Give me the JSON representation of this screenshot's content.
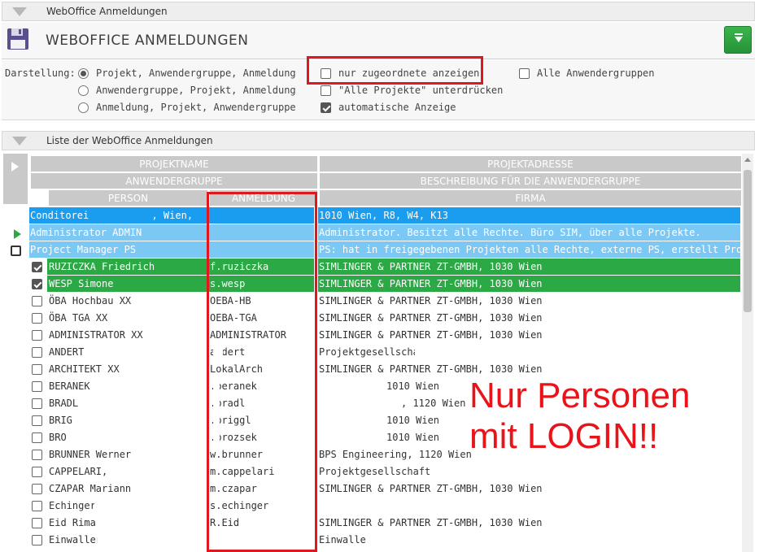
{
  "top_panel": {
    "title": "WebOffice Anmeldungen"
  },
  "title_bar": {
    "title": "WEBOFFICE ANMELDUNGEN",
    "icon": "floppy-disk-icon",
    "action_icon": "download-icon"
  },
  "options": {
    "label": "Darstellung:",
    "radios": [
      {
        "label": "Projekt, Anwendergruppe, Anmeldung",
        "selected": true
      },
      {
        "label": "Anwendergruppe, Projekt, Anmeldung",
        "selected": false
      },
      {
        "label": "Anmeldung, Projekt, Anwendergruppe",
        "selected": false
      }
    ],
    "checkboxes": [
      {
        "label": "nur zugeordnete anzeigen",
        "checked": false
      },
      {
        "label": "\"Alle Projekte\" unterdrücken",
        "checked": false
      },
      {
        "label": "automatische Anzeige",
        "checked": true
      },
      {
        "label": "Alle Anwendergruppen",
        "checked": false
      }
    ]
  },
  "list_panel": {
    "title": "Liste der WebOffice Anmeldungen"
  },
  "headers": {
    "projektname": "PROJEKTNAME",
    "projektadresse": "PROJEKTADRESSE",
    "anwendergruppe": "ANWENDERGRUPPE",
    "beschreibung": "BESCHREIBUNG FÜR DIE ANWENDERGRUPPE",
    "person": "PERSON",
    "anmeldung": "ANMELDUNG",
    "firma": "FIRMA"
  },
  "project_row": {
    "name": "Conditorei ",
    "name2": ", Wien,",
    "address": "1010 Wien, R8, W4, K13"
  },
  "group_rows": [
    {
      "name": "Administrator ADMIN",
      "description": "Administrator. Besitzt alle Rechte. Büro SIM, über alle Projekte."
    },
    {
      "name": "Project Manager PS",
      "description": "PS: hat in freigegebenen Projekten alle Rechte, externe PS, erstellt Projektbesprechu"
    }
  ],
  "person_rows": [
    {
      "person": "RUZICZKA Friedrich",
      "login": "f.ruziczka",
      "firma": "SIMLINGER & PARTNER ZT-GMBH, 1030 Wien",
      "checked": true,
      "highlight": true
    },
    {
      "person": "WESP Simone",
      "login": "s.wesp",
      "firma": "SIMLINGER & PARTNER ZT-GMBH, 1030 Wien",
      "checked": true,
      "highlight": true
    },
    {
      "person": "ÖBA Hochbau XX",
      "login": "OEBA-HB",
      "firma": "SIMLINGER & PARTNER ZT-GMBH, 1030 Wien",
      "checked": false,
      "highlight": false
    },
    {
      "person": "ÖBA TGA XX",
      "login": "OEBA-TGA",
      "firma": "SIMLINGER & PARTNER ZT-GMBH, 1030 Wien",
      "checked": false,
      "highlight": false
    },
    {
      "person": "ADMINISTRATOR XX",
      "login": "ADMINISTRATOR",
      "firma": "SIMLINGER & PARTNER ZT-GMBH, 1030 Wien",
      "checked": false,
      "highlight": false
    },
    {
      "person": "ANDERT",
      "login": "andert",
      "firma": "Projektgesellschaft",
      "checked": false,
      "highlight": false
    },
    {
      "person": "ARCHITEKT XX",
      "login": "LokalArch",
      "firma": "SIMLINGER & PARTNER ZT-GMBH, 1030 Wien",
      "checked": false,
      "highlight": false
    },
    {
      "person": "BERANEK",
      "login": ".beranek",
      "firma": "1010 Wien",
      "checked": false,
      "highlight": false
    },
    {
      "person": "BRADL",
      "login": ".bradl",
      "firma": ", 1120 Wien",
      "checked": false,
      "highlight": false
    },
    {
      "person": "BRIG",
      "login": ".briggl",
      "firma": "1010 Wien",
      "checked": false,
      "highlight": false
    },
    {
      "person": "BRO",
      "login": ".brozsek",
      "firma": "1010 Wien",
      "checked": false,
      "highlight": false
    },
    {
      "person": "BRUNNER Werner",
      "login": "w.brunner",
      "firma": "BPS Engineering, 1120 Wien",
      "checked": false,
      "highlight": false
    },
    {
      "person": "CAPPELARI,",
      "login": "m.cappelari",
      "firma": "Projektgesellschaft",
      "checked": false,
      "highlight": false
    },
    {
      "person": "CZAPAR Mariann",
      "login": "m.czapar",
      "firma": "SIMLINGER & PARTNER ZT-GMBH, 1030 Wien",
      "checked": false,
      "highlight": false
    },
    {
      "person": "Echinger",
      "login": "s.echinger",
      "firma": "",
      "checked": false,
      "highlight": false
    },
    {
      "person": "Eid Rima",
      "login": "R.Eid",
      "firma": "SIMLINGER & PARTNER ZT-GMBH, 1030 Wien",
      "checked": false,
      "highlight": false
    },
    {
      "person": "Einwaller",
      "login": "",
      "firma": "Einwaller",
      "checked": false,
      "highlight": false
    }
  ],
  "annotation": {
    "line1": "Nur Personen",
    "line2": "mit LOGIN!!"
  },
  "colors": {
    "project": "#1a9dee",
    "group": "#7cc8f5",
    "selected": "#2aa944",
    "annotation": "#e8141a",
    "header": "#c9c9c9"
  }
}
